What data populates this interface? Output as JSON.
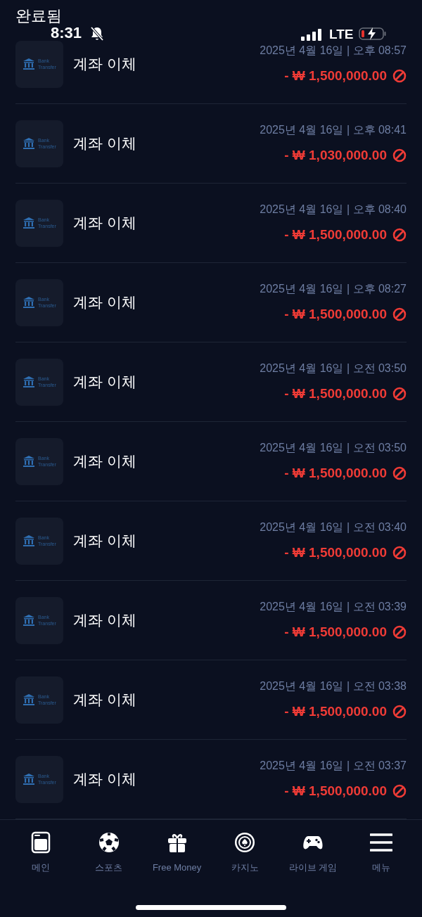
{
  "status_bar": {
    "back_label": "완료됨",
    "time": "8:31",
    "network": "LTE"
  },
  "transactions": [
    {
      "title": "계좌 이체",
      "icon_caption": "Bank Transfer",
      "date": "2025년 4월 16일 | 오후 08:57",
      "amount": "- ₩ 1,500,000.00"
    },
    {
      "title": "계좌 이체",
      "icon_caption": "Bank Transfer",
      "date": "2025년 4월 16일 | 오후 08:41",
      "amount": "- ₩ 1,030,000.00"
    },
    {
      "title": "계좌 이체",
      "icon_caption": "Bank Transfer",
      "date": "2025년 4월 16일 | 오후 08:40",
      "amount": "- ₩ 1,500,000.00"
    },
    {
      "title": "계좌 이체",
      "icon_caption": "Bank Transfer",
      "date": "2025년 4월 16일 | 오후 08:27",
      "amount": "- ₩ 1,500,000.00"
    },
    {
      "title": "계좌 이체",
      "icon_caption": "Bank Transfer",
      "date": "2025년 4월 16일 | 오전 03:50",
      "amount": "- ₩ 1,500,000.00"
    },
    {
      "title": "계좌 이체",
      "icon_caption": "Bank Transfer",
      "date": "2025년 4월 16일 | 오전 03:50",
      "amount": "- ₩ 1,500,000.00"
    },
    {
      "title": "계좌 이체",
      "icon_caption": "Bank Transfer",
      "date": "2025년 4월 16일 | 오전 03:40",
      "amount": "- ₩ 1,500,000.00"
    },
    {
      "title": "계좌 이체",
      "icon_caption": "Bank Transfer",
      "date": "2025년 4월 16일 | 오전 03:39",
      "amount": "- ₩ 1,500,000.00"
    },
    {
      "title": "계좌 이체",
      "icon_caption": "Bank Transfer",
      "date": "2025년 4월 16일 | 오전 03:38",
      "amount": "- ₩ 1,500,000.00"
    },
    {
      "title": "계좌 이체",
      "icon_caption": "Bank Transfer",
      "date": "2025년 4월 16일 | 오전 03:37",
      "amount": "- ₩ 1,500,000.00"
    }
  ],
  "bottom_nav": [
    {
      "kind": "main",
      "label": "메인"
    },
    {
      "kind": "sports",
      "label": "스포츠"
    },
    {
      "kind": "gift",
      "label": "Free Money"
    },
    {
      "kind": "casino",
      "label": "카지노"
    },
    {
      "kind": "live",
      "label": "라이브 게임"
    },
    {
      "kind": "menu",
      "label": "메뉴"
    }
  ]
}
